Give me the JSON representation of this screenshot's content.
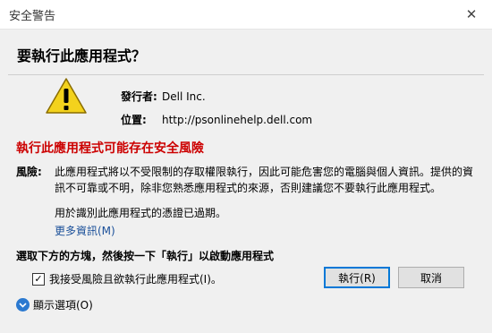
{
  "window": {
    "title": "安全警告"
  },
  "dialog": {
    "heading": "要執行此應用程式？",
    "publisher_label": "發行者:",
    "publisher_value": "Dell Inc.",
    "location_label": "位置:",
    "location_value": "http://psonlinehelp.dell.com",
    "risk_text": "執行此應用程式可能存在安全風險",
    "reason_label": "風險:",
    "reason_text": "此應用程式將以不受限制的存取權限執行，因此可能危害您的電腦與個人資訊。提供的資訊不可靠或不明，除非您熟悉應用程式的來源，否則建議您不要執行此應用程式。",
    "expired_text": "用於識別此應用程式的憑證已過期。",
    "more_info_link": "更多資訊(M)",
    "instruction": "選取下方的方塊，然後按一下「執行」以啟動應用程式",
    "accept_label": "我接受風險且欲執行此應用程式(I)。",
    "accept_checked": true,
    "run_button": "執行(R)",
    "cancel_button": "取消",
    "show_options": "顯示選項(O)"
  },
  "colors": {
    "risk": "#cc0000",
    "link": "#1a4f99",
    "accent": "#0078d7",
    "warning_yellow": "#f3d21d"
  },
  "icons": {
    "warning": "warning-icon",
    "close": "close-icon",
    "chevron": "chevron-down-icon"
  }
}
